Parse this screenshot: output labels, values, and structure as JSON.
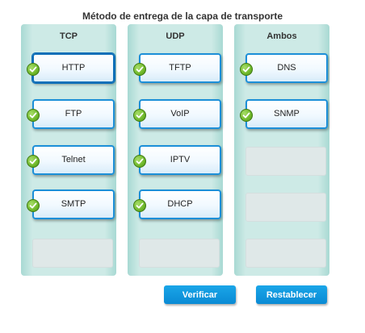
{
  "title": "Método de entrega de la capa de transporte",
  "columns": [
    {
      "header": "TCP",
      "items": [
        "HTTP",
        "FTP",
        "Telnet",
        "SMTP"
      ]
    },
    {
      "header": "UDP",
      "items": [
        "TFTP",
        "VoIP",
        "IPTV",
        "DHCP"
      ]
    },
    {
      "header": "Ambos",
      "items": [
        "DNS",
        "SNMP"
      ]
    }
  ],
  "buttons": {
    "verify": "Verificar",
    "reset": "Restablecer"
  },
  "colors": {
    "column_bg": "#cdeae6",
    "chip_border": "#1c8fd8",
    "button": "#0a8ad4",
    "check": "#6fb82a"
  },
  "icons": {
    "correct": "green-check-icon"
  }
}
